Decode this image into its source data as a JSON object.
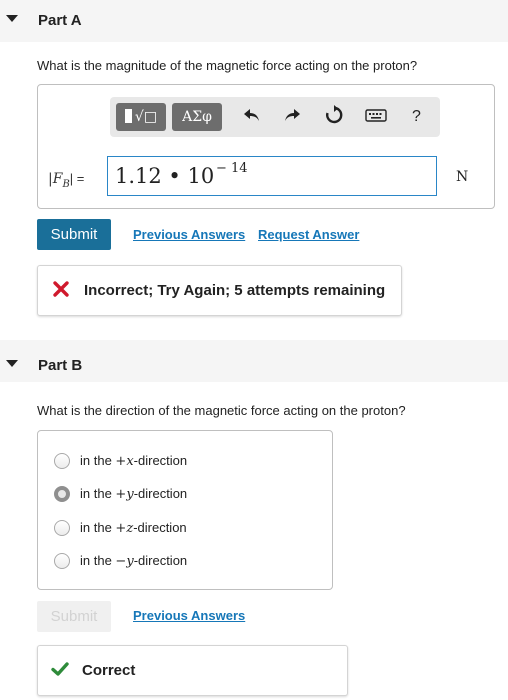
{
  "part_a": {
    "title": "Part A",
    "question": "What is the magnitude of the magnetic force acting on the proton?",
    "toolbar": {
      "templates_label": "√□",
      "greek_label": "ΑΣφ",
      "undo_icon": "undo-icon",
      "redo_icon": "redo-icon",
      "reset_icon": "reset-icon",
      "keyboard_icon": "keyboard-icon",
      "help_label": "?"
    },
    "answer": {
      "label": "|F",
      "label_sub": "B",
      "label_end": "| =",
      "value": "1.12 • 10",
      "exponent": "− 14",
      "unit": "N"
    },
    "submit_label": "Submit",
    "previous_answers_label": "Previous Answers",
    "request_answer_label": "Request Answer",
    "feedback": {
      "status": "incorrect",
      "message": "Incorrect; Try Again; 5 attempts remaining"
    }
  },
  "part_b": {
    "title": "Part B",
    "question": "What is the direction of the magnetic force acting on the proton?",
    "options": [
      {
        "prefix": "in the ",
        "sign": "+",
        "axis": "x",
        "suffix": "-direction",
        "selected": false
      },
      {
        "prefix": "in the ",
        "sign": "+",
        "axis": "y",
        "suffix": "-direction",
        "selected": true
      },
      {
        "prefix": "in the ",
        "sign": "+",
        "axis": "z",
        "suffix": "-direction",
        "selected": false
      },
      {
        "prefix": "in the ",
        "sign": "−",
        "axis": "y",
        "suffix": "-direction",
        "selected": false
      }
    ],
    "submit_label": "Submit",
    "previous_answers_label": "Previous Answers",
    "feedback": {
      "status": "correct",
      "message": "Correct"
    }
  },
  "colors": {
    "submit_active": "#1a6f99",
    "link": "#1677b8",
    "incorrect": "#d0192d",
    "correct": "#2e8b3a"
  }
}
